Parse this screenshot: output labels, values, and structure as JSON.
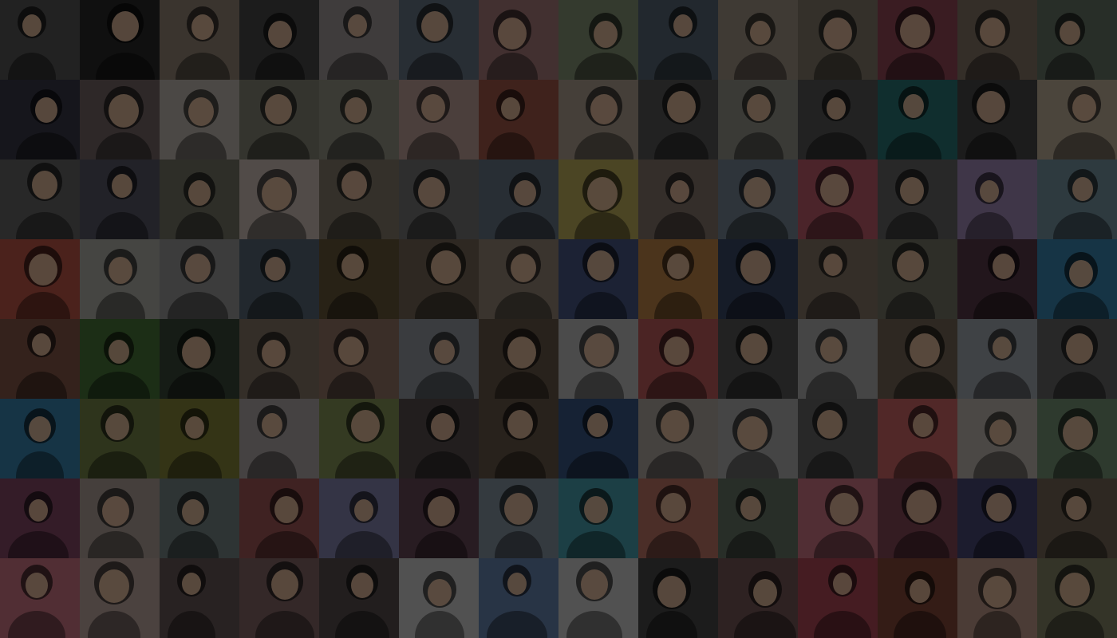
{
  "mosaic": {
    "overlay_color": "#000000",
    "tiles": [
      [
        "#5a5a5a",
        "#2a2a2a",
        "#9a8a7a",
        "#4a4a4a",
        "#a8a0a0",
        "#6a7a8a",
        "#b08080",
        "#8a9a7a",
        "#5a6a7a",
        "#a89a8a",
        "#8a8070",
        "#9a4a5a",
        "#8a7a6a",
        "#6a7a6a"
      ],
      [
        "#3a3a4a",
        "#7a6a6a",
        "#c8c0b8",
        "#8a8a7a",
        "#9a9a8a",
        "#c8a8a0",
        "#a85a4a",
        "#b8a898",
        "#5a5a5a",
        "#9a9a90",
        "#5a5a5a",
        "#2a7a7a",
        "#4a4a4a",
        "#c8b8a0"
      ],
      [
        "#6a6a6a",
        "#5a5a6a",
        "#7a7a6a",
        "#d8c8c0",
        "#8a8070",
        "#7a7a7a",
        "#6a7a8a",
        "#c8b860",
        "#8a7a70",
        "#7a8a9a",
        "#c86070",
        "#6a6a6a",
        "#a890c0",
        "#7a9aa8"
      ],
      [
        "#c85a4a",
        "#b8b8b0",
        "#a0a0a0",
        "#5a6a7a",
        "#6a5a3a",
        "#7a6a5a",
        "#9a8a7a",
        "#4a5a8a",
        "#c88a4a",
        "#3a4a6a",
        "#8a7a6a",
        "#7a7a6a",
        "#5a3a4a",
        "#3a8ab8"
      ],
      [
        "#8a5a4a",
        "#4a7a3a",
        "#3a4a3a",
        "#8a7a6a",
        "#9a7a6a",
        "#9aa0a8",
        "#6a5a4a",
        "#c8c8c8",
        "#c86060",
        "#5a5a5a",
        "#b8b8b8",
        "#7a6a5a",
        "#a8b0b8",
        "#6a6a6a"
      ],
      [
        "#3a8ab8",
        "#7a8a4a",
        "#8a8a3a",
        "#b8b0b0",
        "#8a9a5a",
        "#5a5050",
        "#6a5a4a",
        "#3a5a8a",
        "#b8b0a8",
        "#b8b8b8",
        "#6a6a6a",
        "#d86a6a",
        "#c8c0b8",
        "#7a9a7a"
      ],
      [
        "#8a4a6a",
        "#b8a8a0",
        "#7a8a8a",
        "#a85a5a",
        "#8a8ab8",
        "#6a4a5a",
        "#8a9aa8",
        "#4aa8b8",
        "#c87a6a",
        "#6a7a6a",
        "#d87a8a",
        "#8a4a5a",
        "#4a4a7a",
        "#7a6a5a"
      ],
      [
        "#d87a8a",
        "#c8b0a8",
        "#6a5a5a",
        "#8a6a6a",
        "#5a5050",
        "#d8d8d8",
        "#6a8ab8",
        "#d8d8d8",
        "#4a4a4a",
        "#7a5a5a",
        "#b84a5a",
        "#8a4a3a",
        "#c8a090",
        "#8a8a6a"
      ]
    ]
  }
}
